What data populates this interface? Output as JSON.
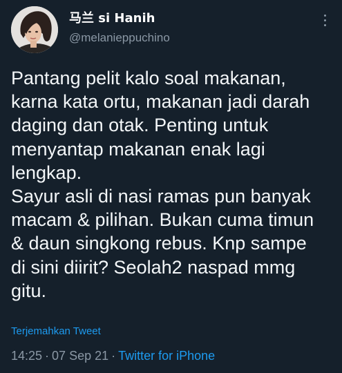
{
  "user": {
    "display_name": "马兰 si Hanih",
    "handle": "@melanieppuchino",
    "avatar": "profile-photo"
  },
  "tweet": {
    "text": "Pantang pelit kalo soal makanan,\nkarna kata ortu, makanan jadi darah\ndaging dan otak. Penting untuk\nmenyantap makanan enak lagi\nlengkap.\nSayur asli di nasi ramas pun banyak\nmacam & pilihan. Bukan cuma timun\n& daun singkong rebus. Knp sampe\ndi sini diirit? Seolah2 naspad mmg\ngitu.",
    "translate_label": "Terjemahkan Tweet",
    "time": "14:25",
    "separator": "·",
    "date": "07 Sep 21",
    "source": "Twitter for iPhone"
  },
  "icons": {
    "more": "more-vertical-icon"
  },
  "colors": {
    "background": "#15202b",
    "text": "#ffffff",
    "secondary": "#8b98a5",
    "accent": "#1d9bf0"
  }
}
